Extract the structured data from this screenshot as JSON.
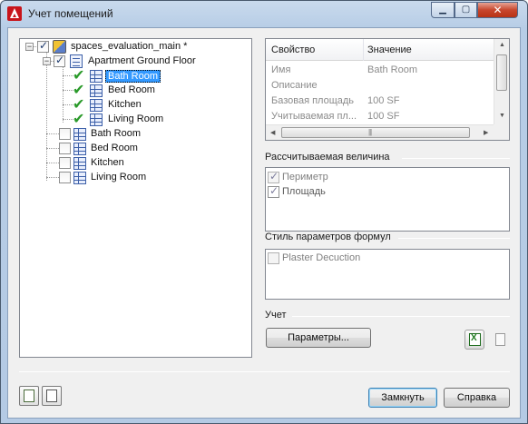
{
  "window": {
    "title": "Учет помещений",
    "minimize_glyph": "▁",
    "maximize_glyph": "▢",
    "close_glyph": "✕"
  },
  "tree": {
    "root": {
      "label": "spaces_evaluation_main *",
      "checked": true,
      "expander": "−"
    },
    "floor": {
      "label": "Apartment Ground Floor",
      "checked": true,
      "expander": "−"
    },
    "checked_rooms": [
      "Bath Room",
      "Bed Room",
      "Kitchen",
      "Living Room"
    ],
    "unchecked_rooms": [
      "Bath Room",
      "Bed Room",
      "Kitchen",
      "Living Room"
    ],
    "selected_index": 0
  },
  "properties": {
    "headers": {
      "property": "Свойство",
      "value": "Значение"
    },
    "rows": [
      {
        "name": "Имя",
        "value": "Bath Room"
      },
      {
        "name": "Описание",
        "value": ""
      },
      {
        "name": "Базовая площадь",
        "value": "100  SF"
      },
      {
        "name": "Учитываемая пл...",
        "value": "100  SF"
      }
    ]
  },
  "calculated": {
    "label": "Рассчитываемая величина",
    "items": [
      {
        "label": "Периметр",
        "checked": true
      },
      {
        "label": "Площадь",
        "checked": true
      }
    ]
  },
  "formula_style": {
    "label": "Стиль параметров формул",
    "items": [
      {
        "label": "Plaster Decuction",
        "checked": false
      }
    ]
  },
  "accounting": {
    "label": "Учет",
    "params_button": "Параметры..."
  },
  "footer": {
    "close_button": "Замкнуть",
    "help_button": "Справка"
  },
  "icons": {
    "app": "autocad-icon",
    "excel": "excel-export-icon",
    "document": "document-icon"
  }
}
